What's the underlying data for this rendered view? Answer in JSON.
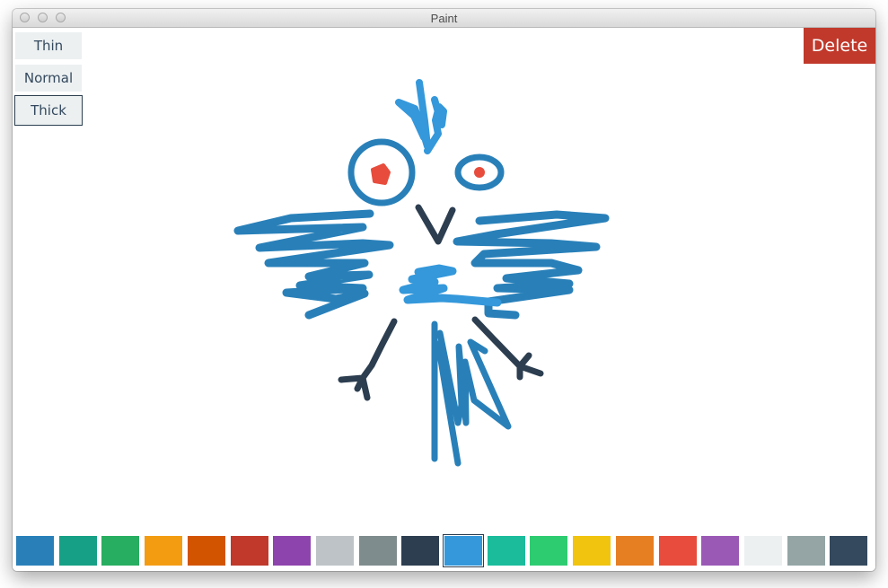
{
  "window": {
    "title": "Paint"
  },
  "toolbar": {
    "widths": [
      {
        "label": "Thin",
        "selected": false
      },
      {
        "label": "Normal",
        "selected": false
      },
      {
        "label": "Thick",
        "selected": true
      }
    ],
    "delete_label": "Delete",
    "delete_color": "#c0392b"
  },
  "palette": {
    "selected_index": 10,
    "colors": [
      "#2980b9",
      "#16a085",
      "#27ae60",
      "#f39c12",
      "#d35400",
      "#c0392b",
      "#8e44ad",
      "#bdc3c7",
      "#7f8c8d",
      "#2c3e50",
      "#3498db",
      "#1abc9c",
      "#2ecc71",
      "#f1c40f",
      "#e67e22",
      "#e74c3c",
      "#9b59b6",
      "#ecf0f1",
      "#95a5a6",
      "#34495e"
    ]
  },
  "drawing": {
    "subject": "bird",
    "stroke_colors": [
      "#2980b9",
      "#3498db",
      "#e74c3c",
      "#2c3e50"
    ]
  }
}
